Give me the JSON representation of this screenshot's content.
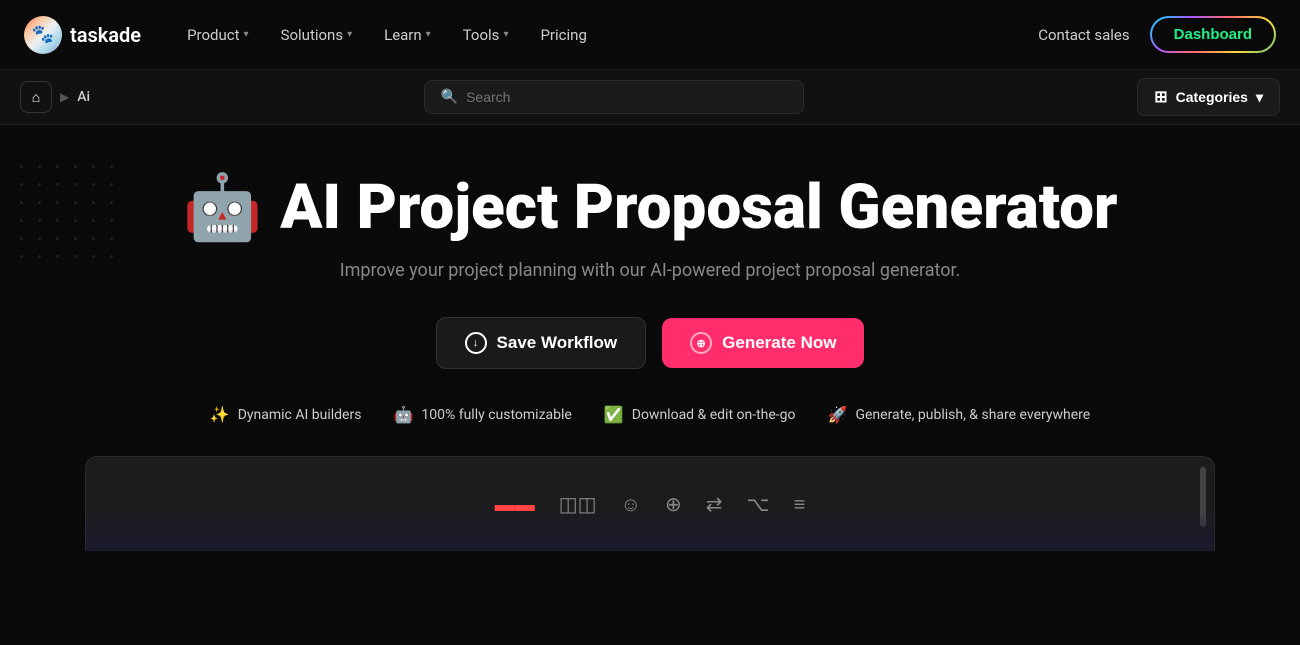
{
  "nav": {
    "logo_text": "taskade",
    "items": [
      {
        "label": "Product",
        "has_dropdown": true
      },
      {
        "label": "Solutions",
        "has_dropdown": true
      },
      {
        "label": "Learn",
        "has_dropdown": true
      },
      {
        "label": "Tools",
        "has_dropdown": true
      },
      {
        "label": "Pricing",
        "has_dropdown": false
      }
    ],
    "contact_sales": "Contact sales",
    "dashboard": "Dashboard"
  },
  "breadcrumb": {
    "home_icon": "🏠",
    "arrow": "▶",
    "label": "Ai"
  },
  "search": {
    "placeholder": "Search",
    "icon": "🔍"
  },
  "categories": {
    "label": "Categories",
    "icon": "⊞"
  },
  "hero": {
    "robot_emoji": "🤖",
    "title": "AI Project Proposal Generator",
    "subtitle": "Improve your project planning with our AI-powered project proposal generator."
  },
  "buttons": {
    "save_workflow": "Save Workflow",
    "generate_now": "Generate Now"
  },
  "features": [
    {
      "emoji": "✨",
      "text": "Dynamic AI builders"
    },
    {
      "emoji": "🤖",
      "text": "100% fully customizable"
    },
    {
      "emoji": "✅",
      "text": "Download & edit on-the-go"
    },
    {
      "emoji": "🚀",
      "text": "Generate, publish, & share everywhere"
    }
  ],
  "toolbar": {
    "icons": [
      "▬▬",
      "◫◫",
      "☺",
      "⊕",
      "⇄",
      "⌥",
      "≡"
    ]
  }
}
